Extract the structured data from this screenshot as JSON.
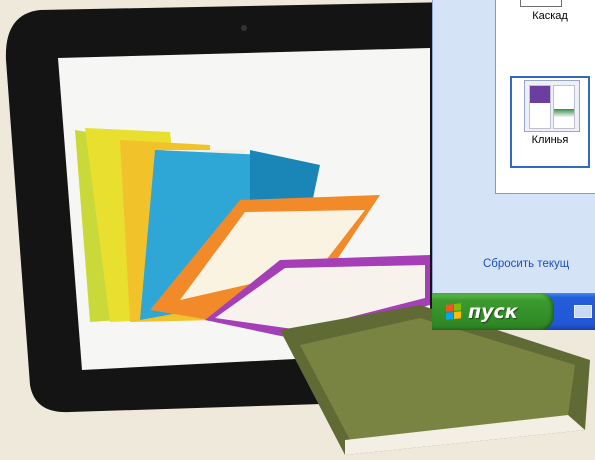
{
  "window": {
    "layouts": [
      {
        "label": "Каскад",
        "icon": "layout-cascade-thumbnail",
        "selected": false
      },
      {
        "label": "Клинья",
        "icon": "layout-wedges-thumbnail",
        "selected": true
      }
    ],
    "reset_link": "Сбросить текущ"
  },
  "taskbar": {
    "start_label": "пуск",
    "start_icon": "windows-flag-icon",
    "quicklaunch_icon": "show-desktop-icon"
  },
  "colors": {
    "xp_blue": "#245edb",
    "start_green": "#3c9b2f",
    "selection": "#316ac5"
  }
}
